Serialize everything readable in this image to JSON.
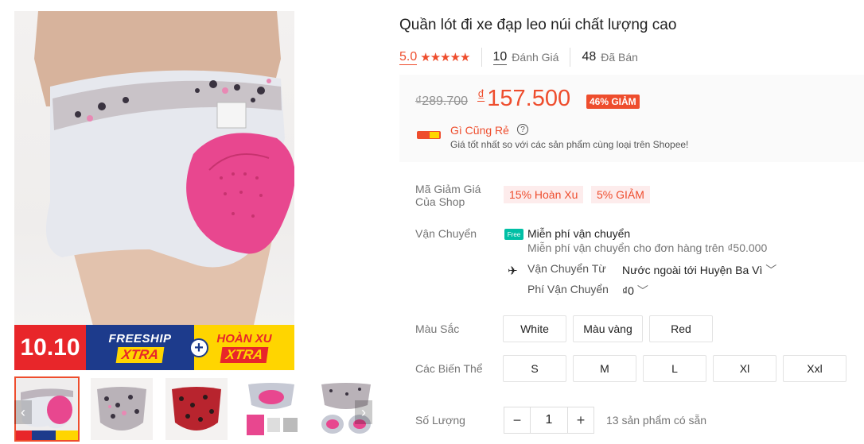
{
  "product": {
    "title": "Quần lót đi xe đạp leo núi chất lượng cao",
    "rating": "5.0",
    "stars": "★★★★★",
    "reviews_count": "10",
    "reviews_label": "Đánh Giá",
    "sold_count": "48",
    "sold_label": "Đã Bán"
  },
  "price": {
    "original": "₫289.700",
    "currency": "₫",
    "current": "157.500",
    "discount": "46% GIẢM",
    "cheap_title": "Gì Cũng Rẻ",
    "cheap_sub": "Giá tốt nhất so với các sản phẩm cùng loại trên Shopee!",
    "help": "?"
  },
  "vouchers": {
    "label": "Mã Giảm Giá Của Shop",
    "items": [
      "15% Hoàn Xu",
      "5% GIẢM"
    ]
  },
  "shipping": {
    "label": "Vận Chuyển",
    "free_badge": "Free",
    "free_title": "Miễn phí vận chuyển",
    "free_sub": "Miễn phí vận chuyển cho đơn hàng trên ₫50.000",
    "from_label": "Vận Chuyển Từ",
    "from_value": "Nước ngoài tới Huyện Ba Vì",
    "fee_label": "Phí Vận Chuyển",
    "fee_value": "₫0"
  },
  "color": {
    "label": "Màu Sắc",
    "options": [
      "White",
      "Màu vàng",
      "Red"
    ]
  },
  "variant": {
    "label": "Các Biến Thể",
    "options": [
      "S",
      "M",
      "L",
      "Xl",
      "Xxl"
    ]
  },
  "quantity": {
    "label": "Số Lượng",
    "minus": "−",
    "value": "1",
    "plus": "+",
    "stock": "13 sản phẩm có sẵn"
  },
  "banner": {
    "date": "10.10",
    "freeship": "FREESHIP",
    "xtra": "XTRA",
    "hoanxu": "HOÀN XU",
    "plus": "+"
  },
  "colors": {
    "accent": "#ee4d2d",
    "pad_pink": "#e8478f",
    "banner_blue": "#1d3b8c",
    "banner_yellow": "#ffd500",
    "banner_red": "#e8262a"
  }
}
